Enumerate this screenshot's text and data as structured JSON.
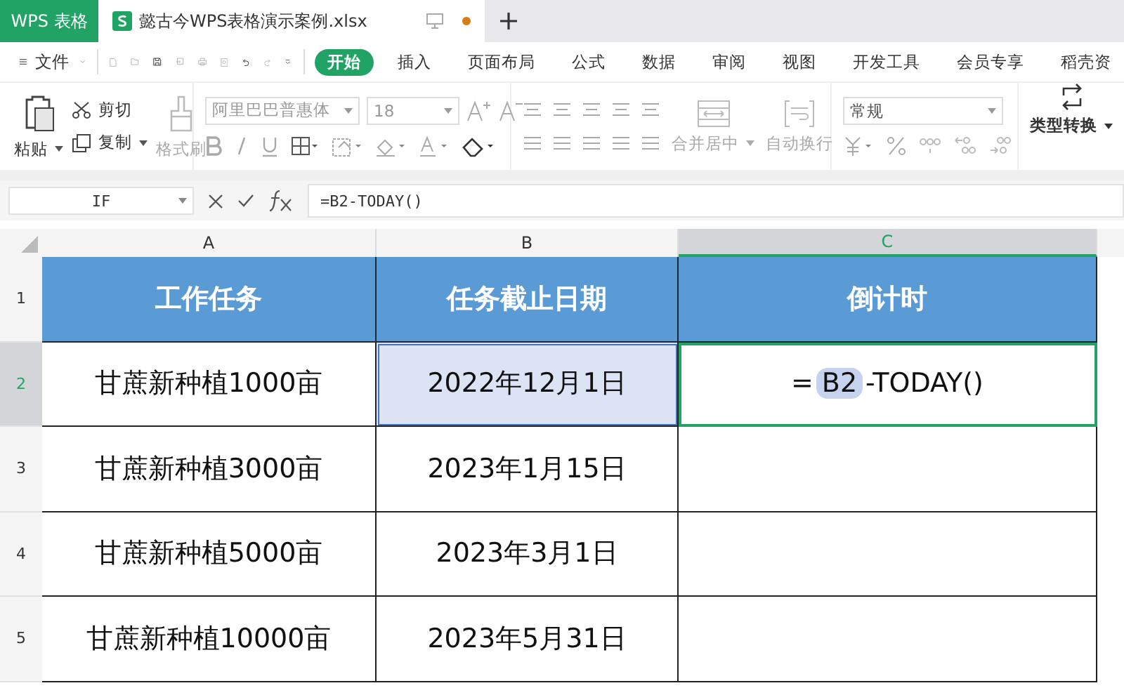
{
  "tabs": [
    {
      "label": "WPS 表格",
      "kind": "home"
    },
    {
      "label": "懿古今WPS表格演示案例.xlsx",
      "kind": "doc",
      "selected": true,
      "modified": true
    }
  ],
  "menu": {
    "file": "文件",
    "items": [
      {
        "label": "开始",
        "selected": true
      },
      {
        "label": "插入",
        "selected": false
      },
      {
        "label": "页面布局",
        "selected": false
      },
      {
        "label": "公式",
        "selected": false
      },
      {
        "label": "数据",
        "selected": false
      },
      {
        "label": "审阅",
        "selected": false
      },
      {
        "label": "视图",
        "selected": false
      },
      {
        "label": "开发工具",
        "selected": false
      },
      {
        "label": "会员专享",
        "selected": false
      },
      {
        "label": "稻壳资",
        "selected": false
      }
    ]
  },
  "ribbon": {
    "paste": "粘贴",
    "cut": "剪切",
    "copy": "复制",
    "format_painter": {
      "label": "格式刷",
      "disabled": true
    },
    "font_name": "阿里巴巴普惠体",
    "font_size": "18",
    "merge": {
      "label": "合并居中",
      "disabled": true
    },
    "wrap": {
      "label": "自动换行",
      "disabled": true
    },
    "number_format": "常规",
    "convert": "类型转换"
  },
  "formula_bar": {
    "name_box": "IF",
    "formula": "=B2-TODAY()"
  },
  "sheet": {
    "columns": [
      {
        "label": "A",
        "selected": false
      },
      {
        "label": "B",
        "selected": false
      },
      {
        "label": "C",
        "selected": true
      }
    ],
    "rows": [
      {
        "number": "1",
        "selected": false,
        "kind": "header",
        "cells": [
          "工作任务",
          "任务截止日期",
          "倒计时"
        ]
      },
      {
        "number": "2",
        "selected": true,
        "kind": "data",
        "cells": [
          "甘蔗新种植1000亩",
          "2022年12月1日",
          ""
        ],
        "editing": {
          "prefix": "=",
          "ref": "B2",
          "suffix": "-TODAY()"
        }
      },
      {
        "number": "3",
        "selected": false,
        "kind": "data",
        "cells": [
          "甘蔗新种植3000亩",
          "2023年1月15日",
          ""
        ]
      },
      {
        "number": "4",
        "selected": false,
        "kind": "data",
        "cells": [
          "甘蔗新种植5000亩",
          "2023年3月1日",
          ""
        ]
      },
      {
        "number": "5",
        "selected": false,
        "kind": "data",
        "cells": [
          "甘蔗新种植10000亩",
          "2023年5月31日",
          ""
        ]
      }
    ]
  }
}
